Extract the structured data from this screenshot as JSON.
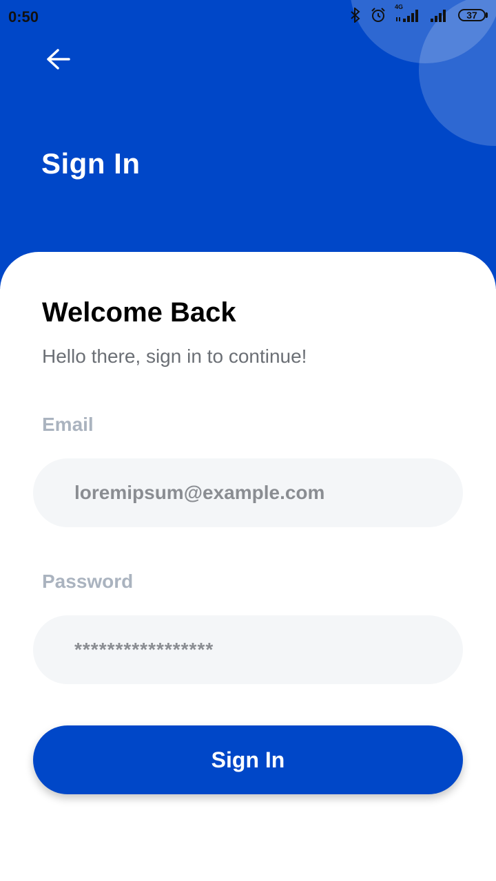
{
  "status_bar": {
    "time": "0:50",
    "network_label": "4G",
    "battery": "37",
    "icons": [
      "bluetooth-icon",
      "alarm-icon",
      "signal-icon",
      "signal-icon",
      "battery-icon"
    ]
  },
  "header": {
    "title": "Sign In",
    "back_icon": "arrow-left-icon"
  },
  "card": {
    "title": "Welcome Back",
    "subtitle": "Hello there, sign in to continue!"
  },
  "form": {
    "email_label": "Email",
    "email_value": "loremipsum@example.com",
    "password_label": "Password",
    "password_value": "*****************",
    "submit_label": "Sign In"
  },
  "colors": {
    "primary": "#0047c8",
    "input_bg": "#f4f6f8",
    "label": "#aab3bf"
  }
}
